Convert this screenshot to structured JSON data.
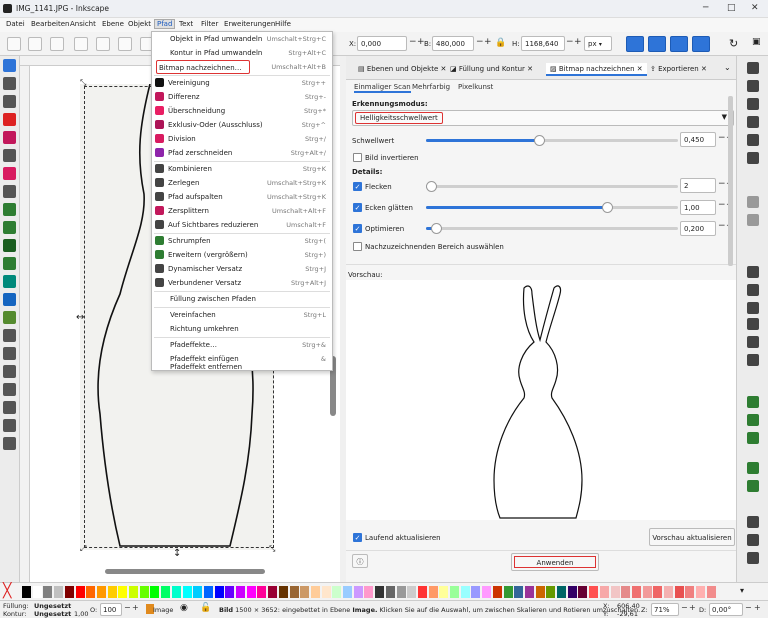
{
  "window": {
    "title": "IMG_1141.JPG - Inkscape"
  },
  "menubar": [
    "Datei",
    "Bearbeiten",
    "Ansicht",
    "Ebene",
    "Objekt",
    "Pfad",
    "Text",
    "Filter",
    "Erweiterungen",
    "Hilfe"
  ],
  "toolbar": {
    "x_label": "X:",
    "x_value": "0,000",
    "y_label": "Y:",
    "w_label": "B:",
    "w_value": "480,000",
    "h_label": "H:",
    "h_value": "1168,640",
    "unit": "px"
  },
  "pfad_menu": [
    {
      "label": "Objekt in Pfad umwandeln",
      "shortcut": "Umschalt+Strg+C",
      "icon": false
    },
    {
      "label": "Kontur in Pfad umwandeln",
      "shortcut": "Strg+Alt+C",
      "icon": false
    },
    {
      "label": "Bitmap nachzeichnen…",
      "shortcut": "Umschalt+Alt+B",
      "icon": false,
      "highlight": true
    },
    {
      "label": "Vereinigung",
      "shortcut": "Strg++",
      "icon": true
    },
    {
      "label": "Differenz",
      "shortcut": "Strg+-",
      "icon": true
    },
    {
      "label": "Überschneidung",
      "shortcut": "Strg+*",
      "icon": true
    },
    {
      "label": "Exklusiv-Oder (Ausschluss)",
      "shortcut": "Strg+^",
      "icon": true
    },
    {
      "label": "Division",
      "shortcut": "Strg+/",
      "icon": true
    },
    {
      "label": "Pfad zerschneiden",
      "shortcut": "Strg+Alt+/",
      "icon": true
    },
    {
      "label": "Kombinieren",
      "shortcut": "Strg+K",
      "icon": true
    },
    {
      "label": "Zerlegen",
      "shortcut": "Umschalt+Strg+K",
      "icon": true
    },
    {
      "label": "Pfad aufspalten",
      "shortcut": "Umschalt+Strg+K",
      "icon": true
    },
    {
      "label": "Zersplittern",
      "shortcut": "Umschalt+Alt+F",
      "icon": true
    },
    {
      "label": "Auf Sichtbares reduzieren",
      "shortcut": "Umschalt+F",
      "icon": true
    },
    {
      "label": "Schrumpfen",
      "shortcut": "Strg+(",
      "icon": true
    },
    {
      "label": "Erweitern (vergrößern)",
      "shortcut": "Strg+)",
      "icon": true
    },
    {
      "label": "Dynamischer Versatz",
      "shortcut": "Strg+J",
      "icon": true
    },
    {
      "label": "Verbundener Versatz",
      "shortcut": "Strg+Alt+J",
      "icon": true
    },
    {
      "label": "Füllung zwischen Pfaden",
      "shortcut": "",
      "icon": false
    },
    {
      "label": "Vereinfachen",
      "shortcut": "Strg+L",
      "icon": false
    },
    {
      "label": "Richtung umkehren",
      "shortcut": "",
      "icon": false
    },
    {
      "label": "Pfadeffekte…",
      "shortcut": "Strg+&",
      "icon": false
    },
    {
      "label": "Pfadeffekt einfügen",
      "shortcut": "&",
      "icon": false
    },
    {
      "label": "Pfadeffekt entfernen",
      "shortcut": "",
      "icon": false
    }
  ],
  "panel": {
    "tabs": [
      "Ebenen und Objekte",
      "Füllung und Kontur",
      "Bitmap nachzeichnen",
      "Exportieren"
    ],
    "subtabs": [
      "Einmaliger Scan",
      "Mehrfarbig",
      "Pixelkunst"
    ],
    "mode_label": "Erkennungsmodus:",
    "mode_value": "Helligkeitsschwellwert",
    "threshold_label": "Schwellwert",
    "threshold_value": "0,450",
    "invert_label": "Bild invertieren",
    "details_label": "Details:",
    "speckles_label": "Flecken",
    "speckles_value": "2",
    "smooth_label": "Ecken glätten",
    "smooth_value": "1,00",
    "optimize_label": "Optimieren",
    "optimize_value": "0,200",
    "area_label": "Nachzuzeichnenden Bereich auswählen",
    "preview_label": "Vorschau:",
    "live_label": "Laufend aktualisieren",
    "refresh_button": "Vorschau aktualisieren",
    "apply_button": "Anwenden",
    "threshold_level": 0.45,
    "speckles_level": 0.02,
    "smooth_level": 0.72,
    "optimize_level": 0.04
  },
  "statusbar": {
    "fill_label": "Füllung:",
    "fill_value": "Ungesetzt",
    "stroke_label": "Kontur:",
    "stroke_value": "Ungesetzt",
    "stroke_width": "1,00",
    "opacity_label": "O:",
    "opacity_value": "100",
    "layer": "Image",
    "message_bold": "Bild",
    "message": " 1500 × 3652: eingebettet in Ebene ",
    "message_bold2": "Image.",
    "message_tail": " Klicken Sie auf die Auswahl, um zwischen Skalieren und Rotieren umzuschalten.",
    "x_label": "X:",
    "x_value": "606,40",
    "y_label": "Y:",
    "y_value": "-29,61",
    "z_label": "Z:",
    "zoom": "71%",
    "d_label": "D:",
    "rotation": "0,00°"
  },
  "colors": {
    "accent": "#2e74d8",
    "highlight_box": "#dd3333",
    "palette": [
      "#000000",
      "#ffffff",
      "#808080",
      "#c0c0c0",
      "#800000",
      "#ff0000",
      "#ff6600",
      "#ff9900",
      "#ffcc00",
      "#ffff00",
      "#ccff00",
      "#66ff00",
      "#00ff00",
      "#00ff66",
      "#00ffcc",
      "#00ffff",
      "#00ccff",
      "#0066ff",
      "#0000ff",
      "#6600ff",
      "#cc00ff",
      "#ff00ff",
      "#ff0099",
      "#990033",
      "#663300",
      "#996633",
      "#cc9966",
      "#ffcc99",
      "#ffe6cc",
      "#ccffcc",
      "#99ccff",
      "#cc99ff",
      "#ff99cc",
      "#333333",
      "#666666",
      "#999999",
      "#cccccc",
      "#ff3333",
      "#ff9966",
      "#ffff99",
      "#99ff99",
      "#99ffff",
      "#9999ff",
      "#ff99ff",
      "#cc3300",
      "#339933",
      "#336699",
      "#993399",
      "#cc6600",
      "#669900",
      "#006666",
      "#330066",
      "#660033",
      "#ff5050",
      "#f7a8a8",
      "#f2c5c5",
      "#e58a8a",
      "#ef7070",
      "#f29a9a",
      "#ef6565",
      "#f4b0b0",
      "#e85050",
      "#f08080",
      "#ffb0b0",
      "#f28c8c"
    ]
  }
}
